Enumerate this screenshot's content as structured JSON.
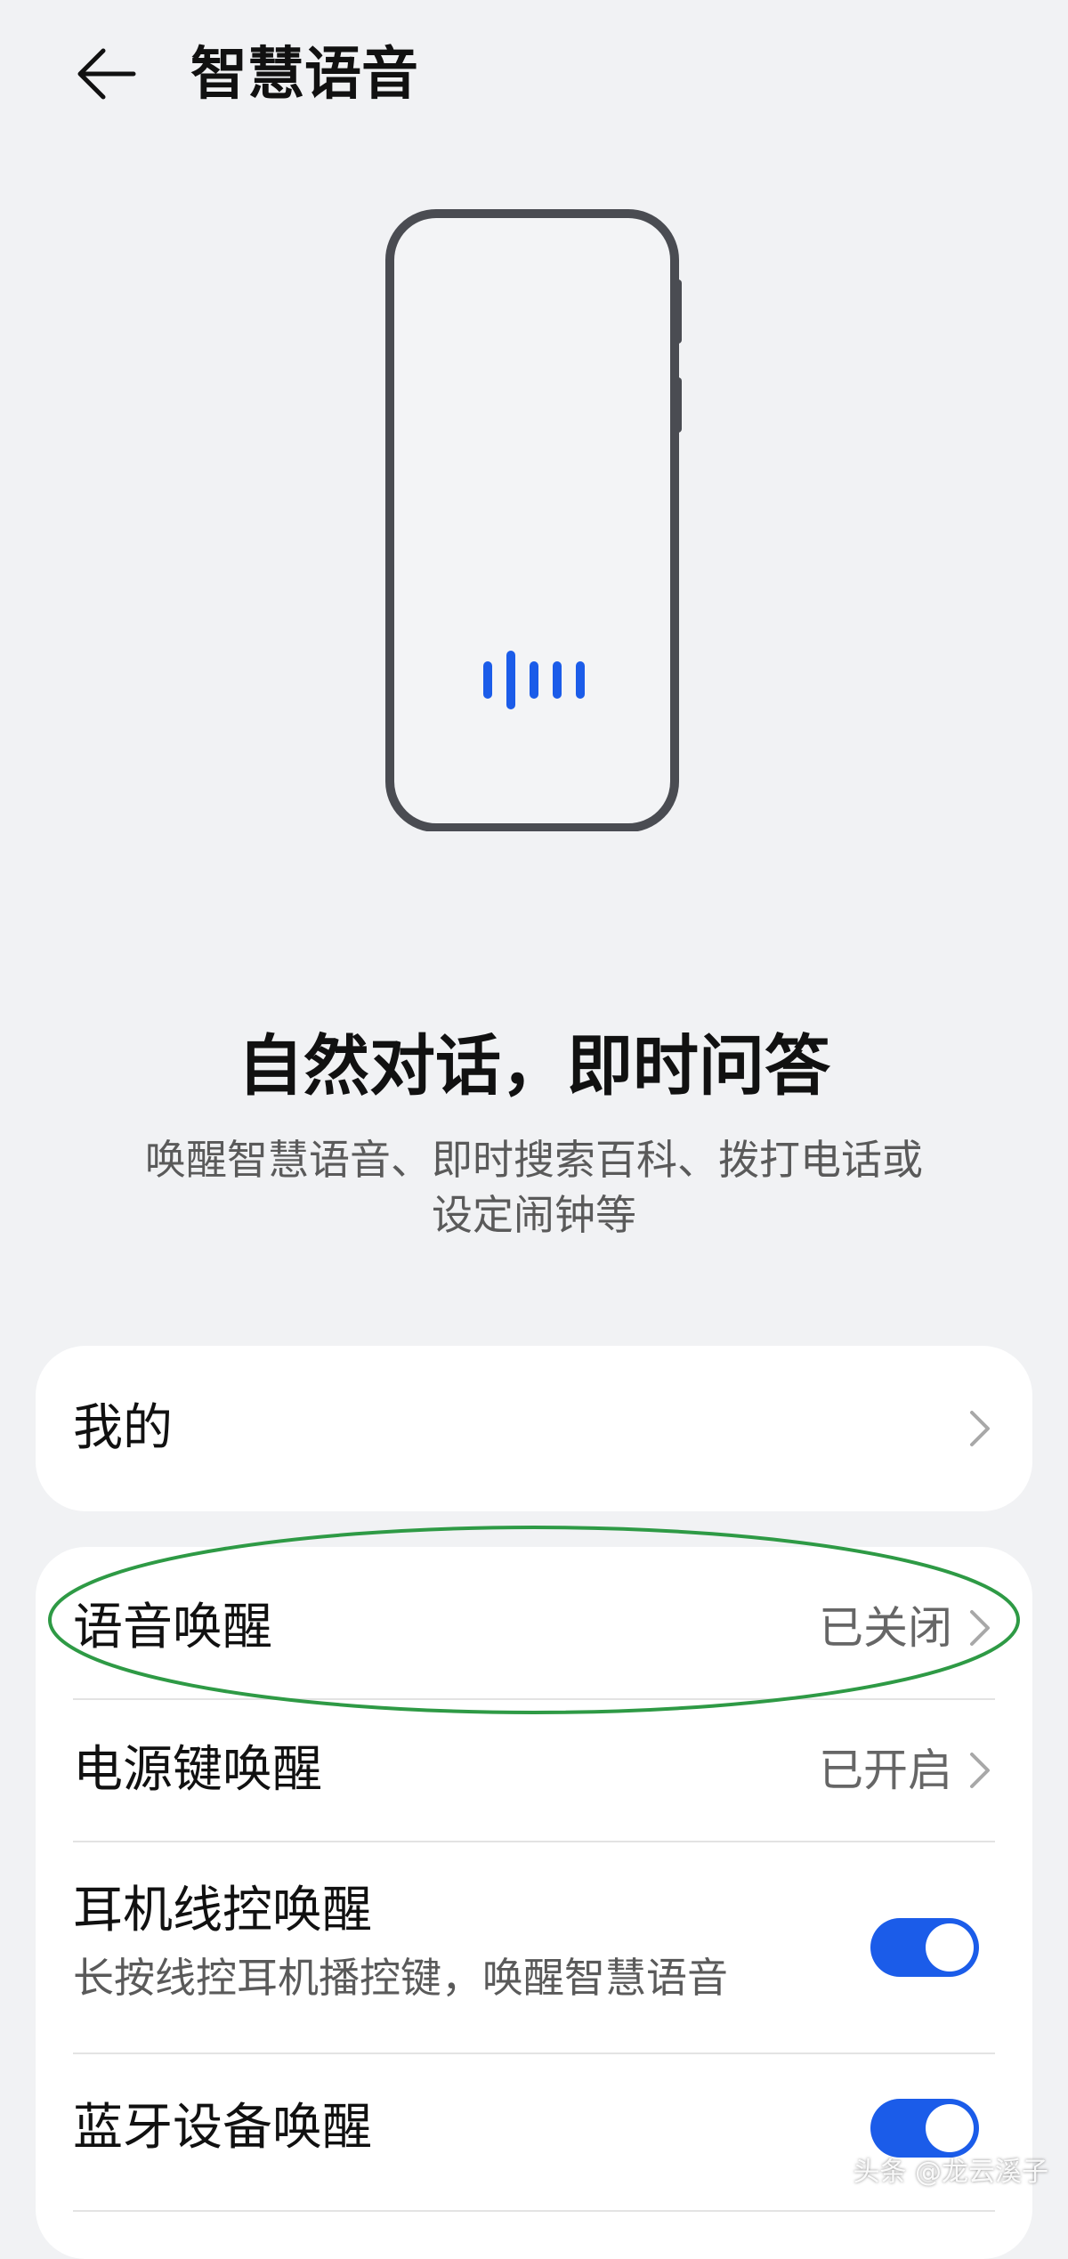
{
  "header": {
    "back_icon": "arrow-left-icon",
    "title": "智慧语音"
  },
  "hero": {
    "illustration_icon": "phone-voice-wave-icon",
    "accent_color": "#1b5ce9"
  },
  "intro": {
    "headline": "自然对话，即时问答",
    "subtitle_line1": "唤醒智慧语音、即时搜索百科、拨打电话或",
    "subtitle_line2": "设定闹钟等"
  },
  "menu_mine": {
    "label": "我的",
    "icon": "chevron-right-icon"
  },
  "wake_settings": {
    "voice_wake": {
      "label": "语音唤醒",
      "value": "已关闭",
      "icon": "chevron-right-icon",
      "annotation_color": "#2e9a45"
    },
    "power_key_wake": {
      "label": "电源键唤醒",
      "value": "已开启",
      "icon": "chevron-right-icon"
    },
    "wired_headset_wake": {
      "label": "耳机线控唤醒",
      "description": "长按线控耳机播控键，唤醒智慧语音",
      "enabled": true
    },
    "bluetooth_wake": {
      "label": "蓝牙设备唤醒",
      "enabled": true
    }
  },
  "watermark": {
    "text": "头条 @龙云溪子"
  },
  "colors": {
    "background": "#f1f2f4",
    "card": "#ffffff",
    "toggle_on": "#1b5ce9",
    "secondary_text": "#666666"
  }
}
